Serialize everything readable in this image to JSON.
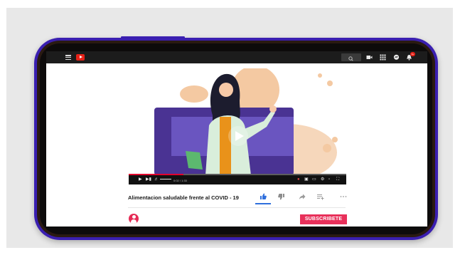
{
  "video": {
    "title": "Alimentacion saludable frente al COVID - 19",
    "progress_fraction": 0.25,
    "time_display": "0:02 / 1:33",
    "notification_count": "9+"
  },
  "channel": {
    "subscribe_label": "SUBSCRIBETE"
  },
  "icons": {
    "menu": "hamburger-menu-icon",
    "logo": "youtube-logo-icon",
    "search": "search-icon",
    "create": "video-camera-icon",
    "apps": "apps-grid-icon",
    "messages": "chat-icon",
    "notifications": "bell-icon",
    "like": "thumbs-up-icon",
    "dislike": "thumbs-down-icon",
    "share": "share-icon",
    "save": "playlist-add-icon",
    "more": "more-icon"
  },
  "colors": {
    "frame": "#3a1fb0",
    "accent": "#e62117",
    "subscribe": "#e8305a",
    "like_active": "#2f6fdc"
  }
}
